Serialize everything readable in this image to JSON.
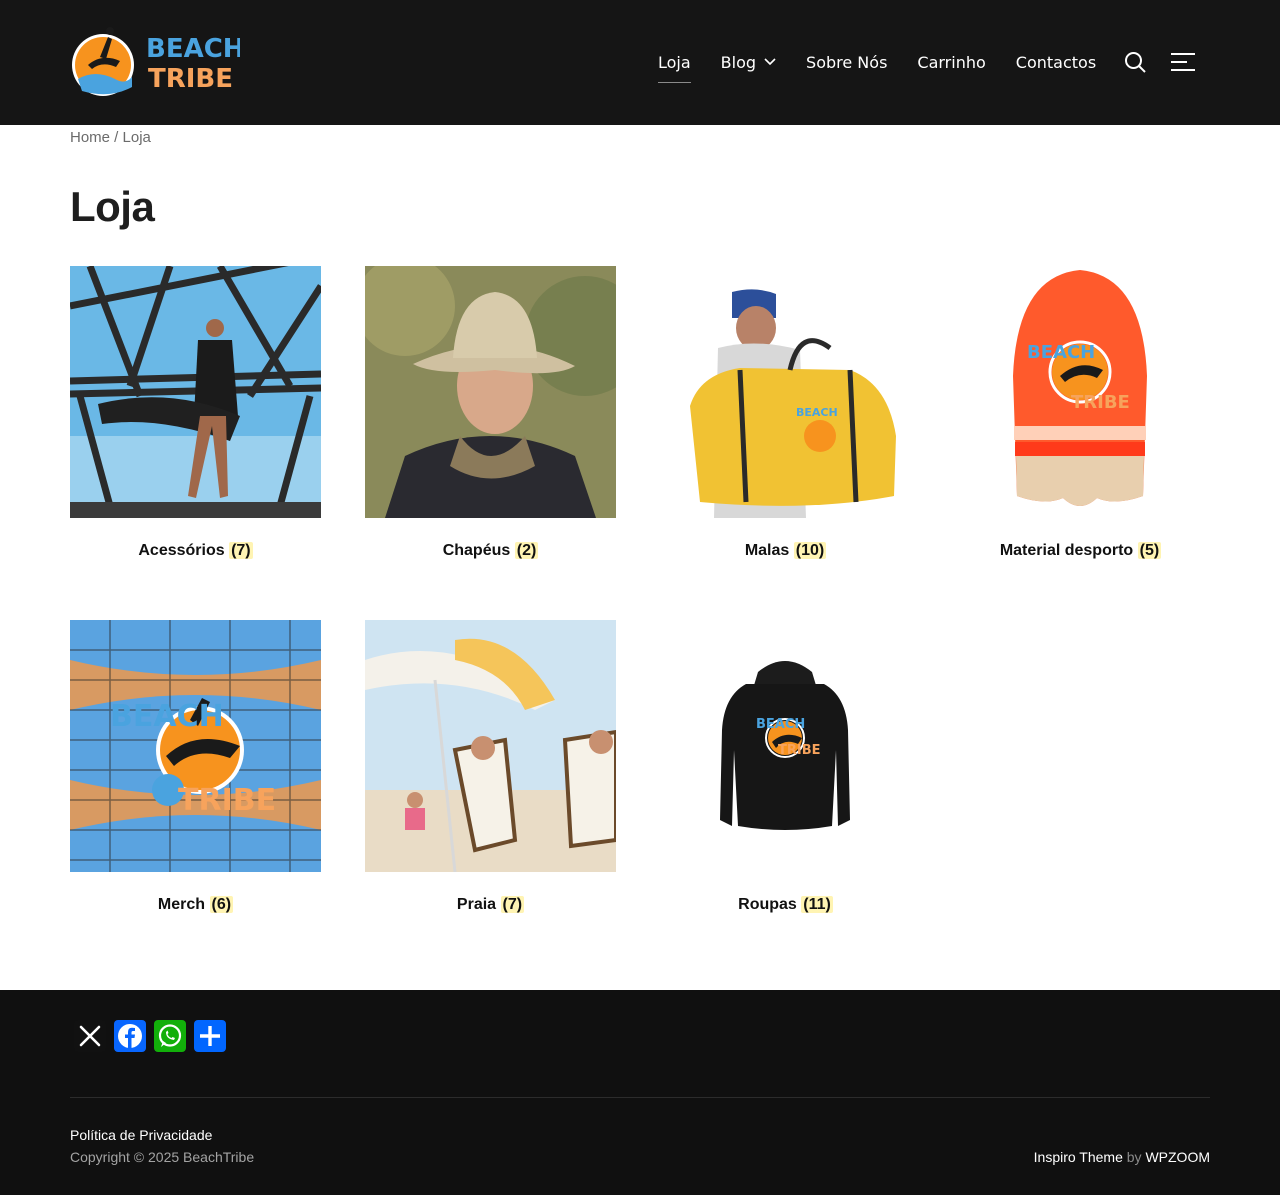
{
  "header": {
    "logo_text_line1": "BEACH",
    "logo_text_line2": "TRIBE",
    "nav": [
      {
        "label": "Loja",
        "active": true
      },
      {
        "label": "Blog",
        "has_dropdown": true
      },
      {
        "label": "Sobre Nós"
      },
      {
        "label": "Carrinho"
      },
      {
        "label": "Contactos"
      }
    ],
    "icons": [
      "search-icon",
      "menu-icon"
    ]
  },
  "breadcrumb": {
    "home": "Home",
    "separator": " / ",
    "current": "Loja"
  },
  "page_title": "Loja",
  "categories": [
    {
      "name": "Acessórios",
      "count": "(7)"
    },
    {
      "name": "Chapéus",
      "count": "(2)"
    },
    {
      "name": "Malas",
      "count": "(10)"
    },
    {
      "name": "Material desporto",
      "count": "(5)"
    },
    {
      "name": "Merch",
      "count": "(6)"
    },
    {
      "name": "Praia",
      "count": "(7)"
    },
    {
      "name": "Roupas",
      "count": "(11)"
    }
  ],
  "footer": {
    "share": [
      "x-icon",
      "facebook-icon",
      "whatsapp-icon",
      "share-icon"
    ],
    "privacy": "Política de Privacidade",
    "copyright": "Copyright © 2025 BeachTribe",
    "credit_theme": "Inspiro Theme",
    "credit_by": "by",
    "credit_author": "WPZOOM"
  },
  "colors": {
    "header_bg": "#151515",
    "footer_bg": "#101010",
    "count_highlight": "#fff4b3",
    "brand_orange": "#f7931e",
    "brand_blue": "#4aa3df"
  }
}
